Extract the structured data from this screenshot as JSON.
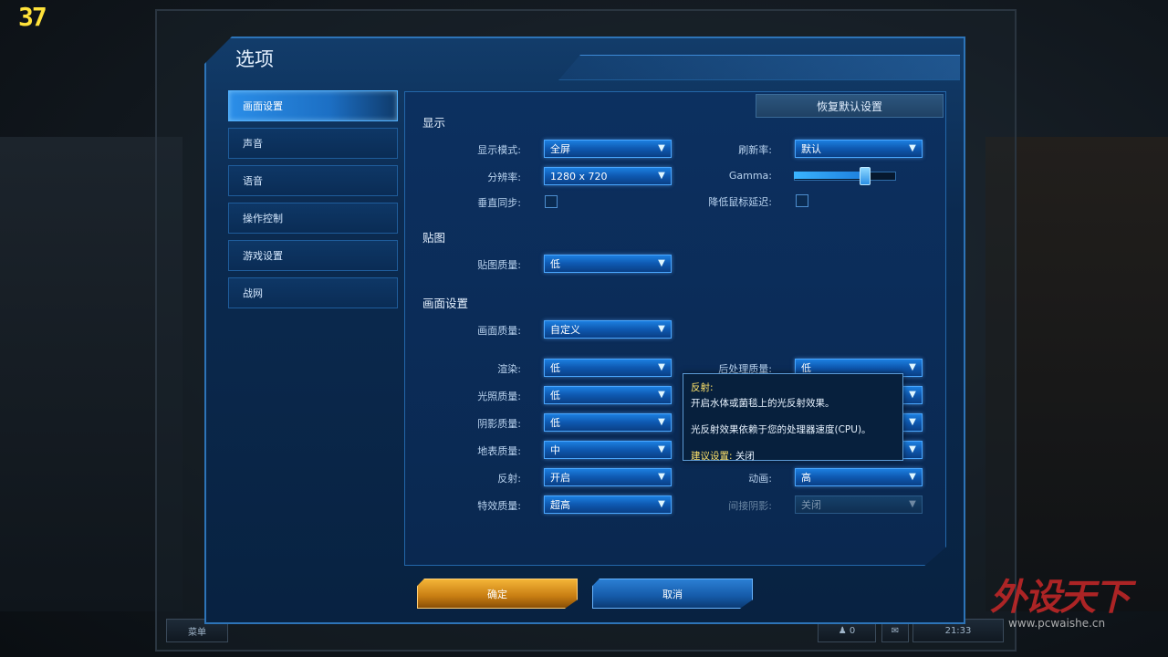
{
  "fps": "37",
  "dialog": {
    "title": "选项",
    "reset_label": "恢复默认设置"
  },
  "sidebar": {
    "items": [
      {
        "label": "画面设置",
        "active": true
      },
      {
        "label": "声音"
      },
      {
        "label": "语音"
      },
      {
        "label": "操作控制"
      },
      {
        "label": "游戏设置"
      },
      {
        "label": "战网"
      }
    ]
  },
  "sections": {
    "display": "显示",
    "textures": "贴图",
    "graphics": "画面设置"
  },
  "display": {
    "mode_label": "显示模式:",
    "mode_value": "全屏",
    "resolution_label": "分辨率:",
    "resolution_value": "1280 x 720",
    "vsync_label": "垂直同步:",
    "refresh_label": "刷新率:",
    "refresh_value": "默认",
    "gamma_label": "Gamma:",
    "gamma_level": 0.7,
    "mouse_lag_label": "降低鼠标延迟:"
  },
  "textures": {
    "quality_label": "贴图质量:",
    "quality_value": "低"
  },
  "graphics": {
    "quality_label": "画面质量:",
    "quality_value": "自定义",
    "render_label": "渲染:",
    "render_value": "低",
    "lighting_label": "光照质量:",
    "lighting_value": "低",
    "shadow_label": "阴影质量:",
    "shadow_value": "低",
    "terrain_label": "地表质量:",
    "terrain_value": "中",
    "reflection_label": "反射:",
    "reflection_value": "开启",
    "effects_label": "特效质量:",
    "effects_value": "超高",
    "post_label": "后处理质量:",
    "post_value": "低",
    "animation_label": "动画:",
    "animation_value": "高",
    "indirect_label": "间接阴影:",
    "indirect_value": "关闭"
  },
  "tooltip": {
    "title": "反射:",
    "line1": "开启水体或菌毯上的光反射效果。",
    "line2": "光反射效果依赖于您的处理器速度(CPU)。",
    "rec_label": "建议设置:",
    "rec_value": "关闭"
  },
  "buttons": {
    "ok": "确定",
    "cancel": "取消"
  },
  "bottom": {
    "menu": "菜单",
    "count": "0",
    "time": "21:33"
  },
  "watermark": {
    "main": "外设天下",
    "url": "www.pcwaishe.cn"
  },
  "colors": {
    "accent": "#2b8ee8",
    "ok": "#e6a02a",
    "tooltip_title": "#ffe36a"
  }
}
